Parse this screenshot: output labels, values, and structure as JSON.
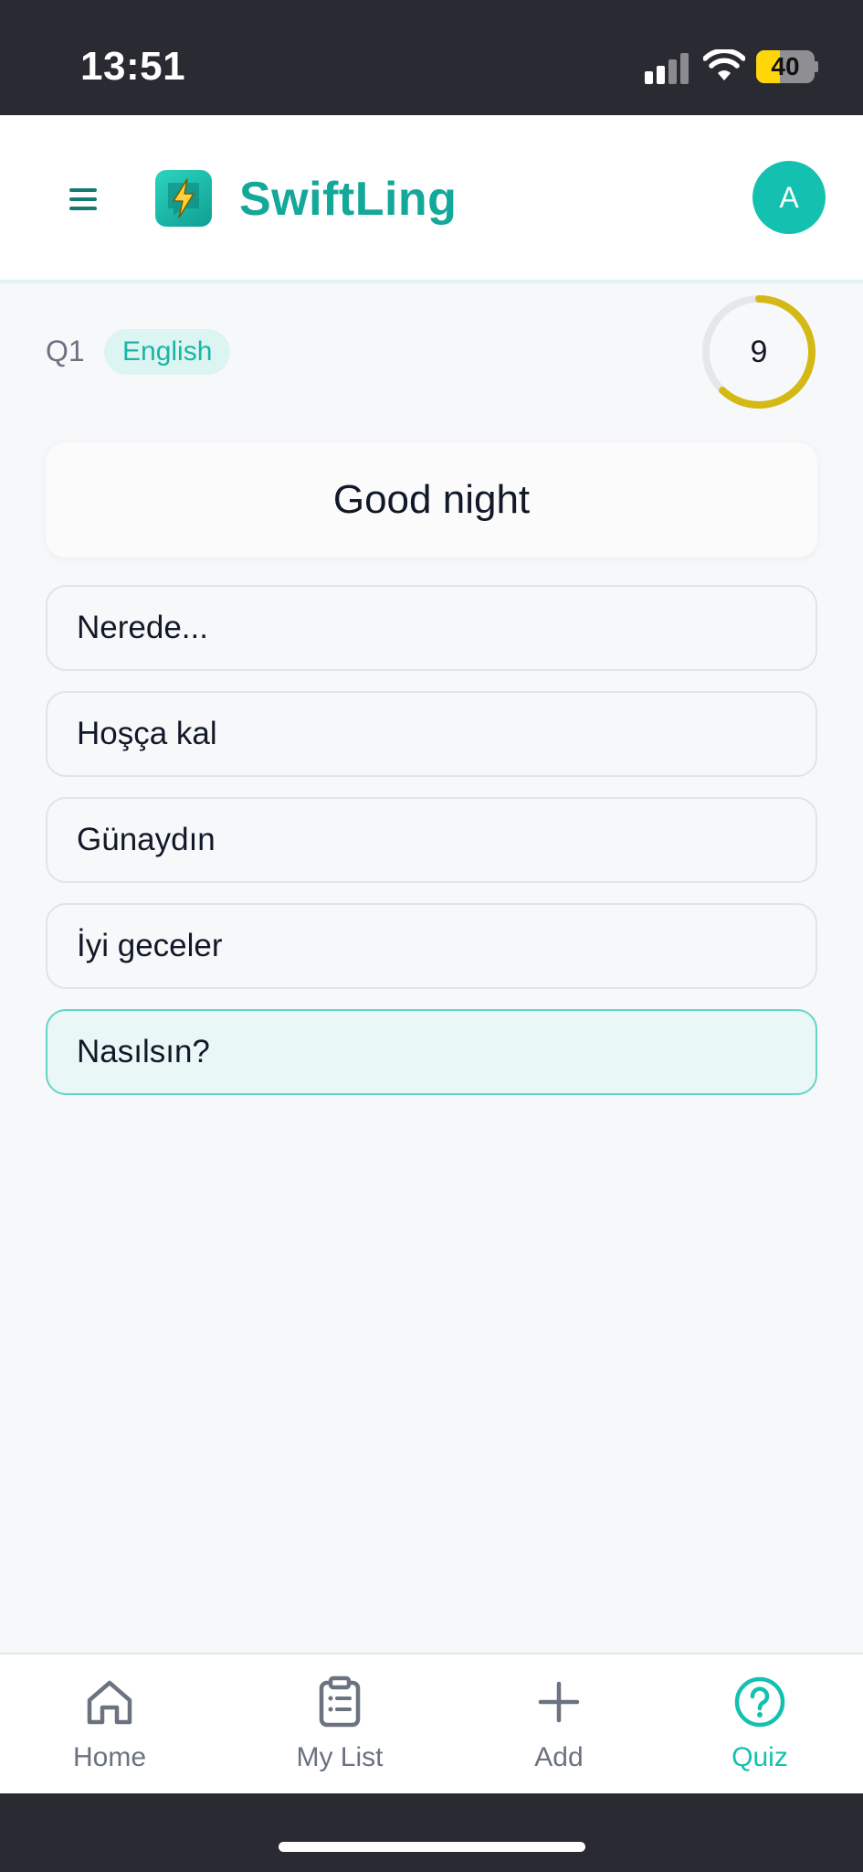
{
  "status_bar": {
    "time": "13:51",
    "battery_level": "40",
    "battery_fraction": 0.4
  },
  "header": {
    "app_name": "SwiftLing",
    "avatar_initial": "A",
    "brand_color": "#14A89A"
  },
  "quiz": {
    "question_number": "Q1",
    "language": "English",
    "timer_value": "9",
    "timer_fraction": 0.62,
    "timer_color": "#D4B814",
    "prompt": "Good night",
    "options": [
      {
        "label": "Nerede...",
        "selected": false
      },
      {
        "label": "Hoşça kal",
        "selected": false
      },
      {
        "label": "Günaydın",
        "selected": false
      },
      {
        "label": "İyi geceler",
        "selected": false
      },
      {
        "label": "Nasılsın?",
        "selected": true
      }
    ]
  },
  "bottom_nav": {
    "items": [
      {
        "label": "Home",
        "icon": "home-icon",
        "active": false
      },
      {
        "label": "My List",
        "icon": "clipboard-list-icon",
        "active": false
      },
      {
        "label": "Add",
        "icon": "plus-icon",
        "active": false
      },
      {
        "label": "Quiz",
        "icon": "question-circle-icon",
        "active": true
      }
    ],
    "accent_color": "#14C1B0"
  }
}
